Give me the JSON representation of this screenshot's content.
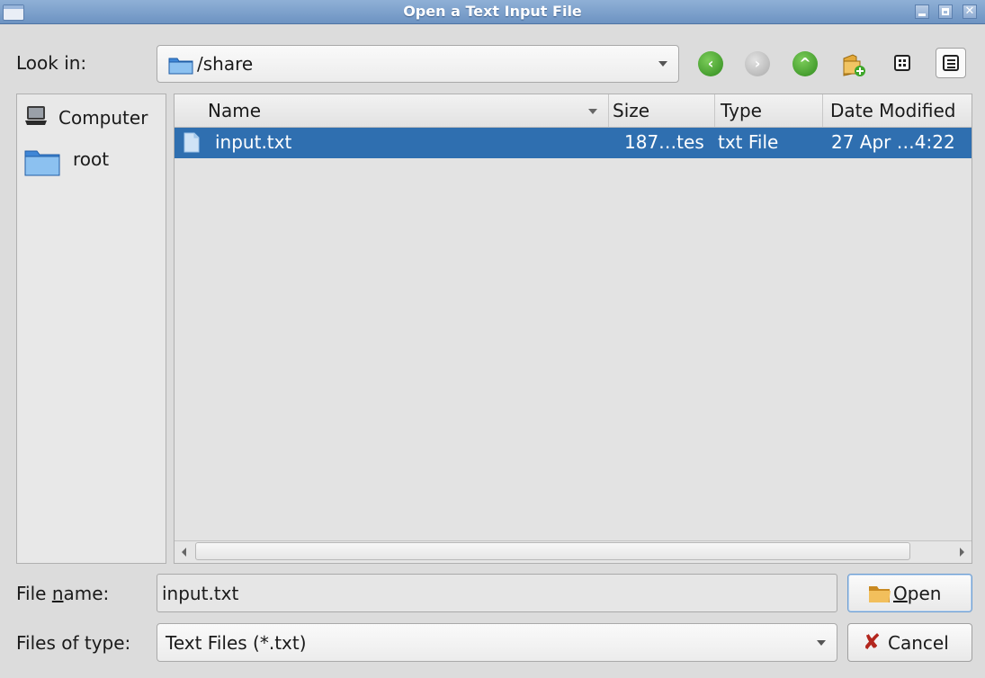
{
  "window": {
    "title": "Open a Text Input File"
  },
  "toolbar": {
    "look_in_label": "Look in:",
    "path": "/share",
    "icons": [
      "back-arrow-icon",
      "forward-arrow-icon",
      "up-arrow-icon",
      "new-folder-icon",
      "list-view-icon",
      "detail-view-icon"
    ]
  },
  "sidebar": {
    "items": [
      {
        "label": "Computer",
        "icon": "computer-icon"
      },
      {
        "label": "root",
        "icon": "folder-icon"
      }
    ]
  },
  "fileview": {
    "columns": [
      "Name",
      "Size",
      "Type",
      "Date Modified"
    ],
    "rows": [
      {
        "name": "input.txt",
        "size": "187…tes",
        "type": "txt File",
        "date": "27 Apr …4:22",
        "selected": true
      }
    ]
  },
  "form": {
    "file_name_label_pre": "File ",
    "file_name_label_mnemonic": "n",
    "file_name_label_post": "ame:",
    "file_name_value": "input.txt",
    "file_type_label": "Files of type:",
    "file_type_value": "Text Files (*.txt)"
  },
  "buttons": {
    "open_mnemonic": "O",
    "open_rest": "pen",
    "cancel": "Cancel"
  },
  "colors": {
    "selection": "#2f6fb0",
    "titlebar": "#7a9ccb"
  }
}
